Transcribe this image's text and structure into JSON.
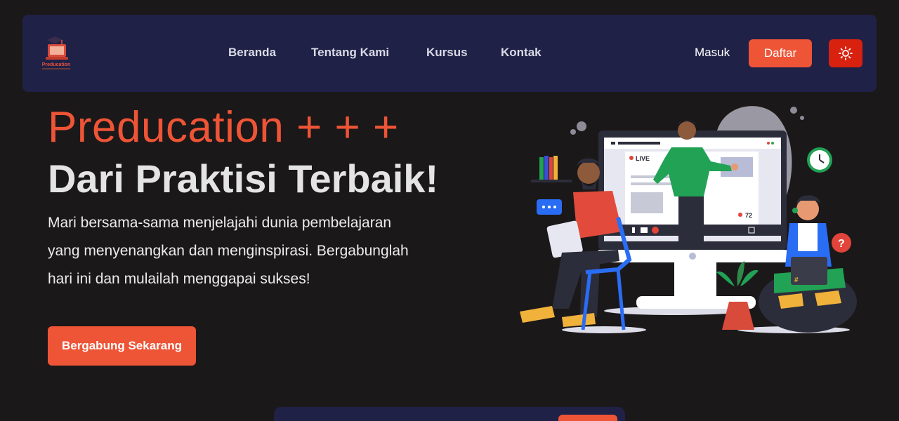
{
  "brand": {
    "name": "Preducation",
    "accent": "#ee5436",
    "navbar_bg": "#1f2147",
    "page_bg": "#1b1819"
  },
  "nav": {
    "links": [
      "Beranda",
      "Tentang Kami",
      "Kursus",
      "Kontak"
    ],
    "login_label": "Masuk",
    "register_label": "Daftar",
    "theme_icon": "sun-icon"
  },
  "hero": {
    "title": "Preducation + + +",
    "subtitle": "Dari Praktisi Terbaik!",
    "description": "Mari bersama-sama menjelajahi dunia pembelajaran yang menyenangkan dan menginspirasi. Bergabunglah hari ini dan mulailah menggapai sukses!",
    "cta_label": "Bergabung Sekarang"
  },
  "illustration": {
    "live_label": "LIVE",
    "viewer_count": "72"
  }
}
